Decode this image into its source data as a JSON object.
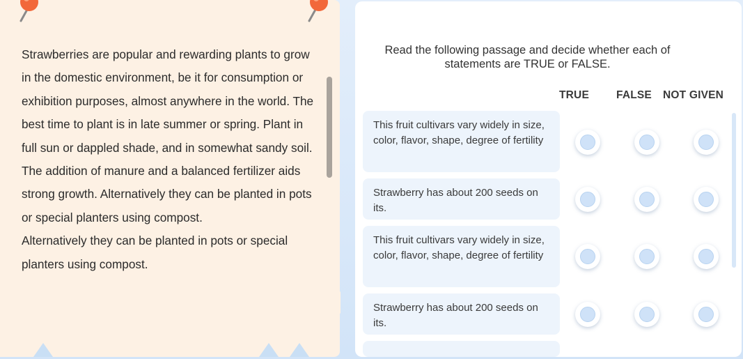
{
  "passage": {
    "paragraphs": [
      "Strawberries are popular and rewarding plants to grow in the domestic environment, be it for consumption or exhibition purposes, almost anywhere in the world. The best time to plant is in late summer or spring. Plant in full sun or dappled shade, and in somewhat sandy soil. The addition of manure and a balanced fertilizer aids strong growth. Alternatively they can be planted in pots or special planters using compost.",
      "Alternatively they can be planted in pots or special planters using compost."
    ]
  },
  "question": {
    "instruction": "Read the following passage and decide whether each of statements are TRUE or FALSE.",
    "columns": [
      "TRUE",
      "FALSE",
      "NOT GIVEN"
    ],
    "statements": [
      "This fruit cultivars vary widely in size, color, flavor, shape, degree of fertility",
      "Strawberry has about 200 seeds on its.",
      "This fruit cultivars vary widely in size, color, flavor, shape, degree of fertility",
      "Strawberry has about 200 seeds on its."
    ]
  },
  "colors": {
    "passage_bg": "#fdf1e4",
    "statement_bg": "#edf4fc",
    "radio_fill": "#cfe2f8",
    "pin": "#f2683a"
  },
  "icons": [
    "pushpin-icon",
    "pushpin-icon"
  ]
}
